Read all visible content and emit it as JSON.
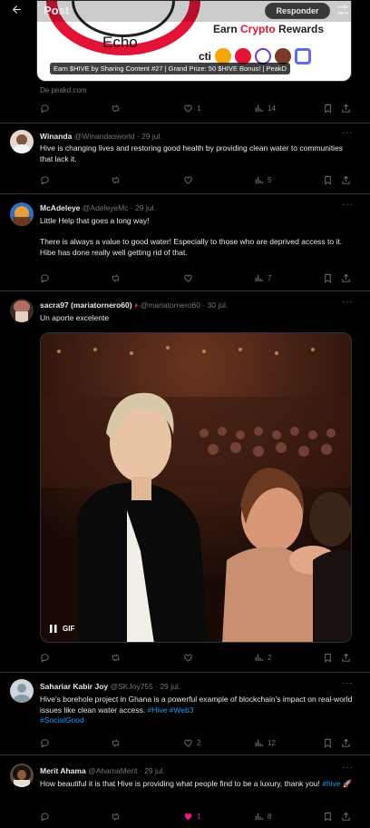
{
  "header": {
    "title": "Post",
    "reply_label": "Responder"
  },
  "card": {
    "echo": "Echo",
    "earn_prefix": "Earn ",
    "earn_red": "Crypto",
    "earn_suffix": " Rewards",
    "caption": "Earn $HIVE by Sharing Content #27 | Grand Prize: 50 $HIVE Bonus! | PeakD",
    "from": "De peakd.com"
  },
  "main_actions": {
    "likes": "1",
    "views": "14"
  },
  "tweets": [
    {
      "name": "Winanda",
      "handle": "@Winandasworld",
      "date": "· 29 jul.",
      "text": "Hive is changing lives and restoring good health by providing clean water to communities that lack it.",
      "views": "5"
    },
    {
      "name": "McAdeleye",
      "handle": "@AdeleyeMc",
      "date": "· 29 jul.",
      "text": "Little Help that goes a long way!\n\nThere is always a value to good water!  Especially to those who are deprived access to it. Hibe has done really well getting rid of that.",
      "views": "7"
    },
    {
      "name": "sacra97 (mariatornero60)",
      "badge": "♦",
      "handle": "@mariatornero60",
      "date": "· 30 jul.",
      "text": "Un aporte excelente",
      "gif_label": "GIF",
      "views": "2"
    },
    {
      "name": "Sahariar Kabir Joy",
      "handle": "@SKJoy755",
      "date": "· 29 jul.",
      "text": "Hive's borehole project in Ghana is a powerful example of blockchain's impact on real-world issues like clean water access. ",
      "hashtags": "#Hive #Web3",
      "hashtags2": "#SocialGood",
      "likes": "2",
      "views": "12"
    },
    {
      "name": "Merit Ahama",
      "handle": "@AhamaMerit",
      "date": "· 29 jul.",
      "text": "How beautiful it is that Hive is providing what people find to be a luxury, thank you! ",
      "hashtags": "#hive",
      "emoji": "🚀",
      "likes": "1",
      "views": "8"
    }
  ],
  "more_label": "···",
  "colors": {
    "accent": "#1d9bf0",
    "muted": "#71767b",
    "like": "#f91880",
    "hive": "#e31337"
  }
}
